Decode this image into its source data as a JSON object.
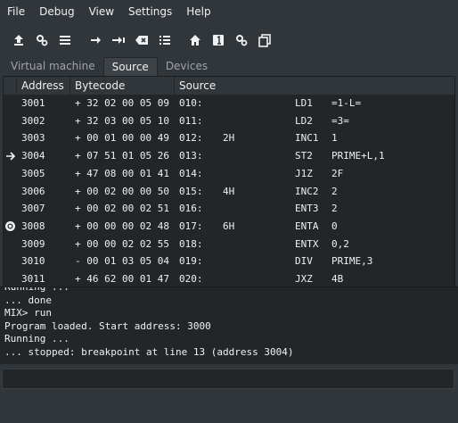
{
  "menu": [
    "File",
    "Debug",
    "View",
    "Settings",
    "Help"
  ],
  "toolbar": {
    "buttons": [
      "upload-icon",
      "gear-icon",
      "list-lines-icon",
      "arrow-right-icon",
      "step-into-icon",
      "clear-breakpoint-icon",
      "bullet-list-icon",
      "home-icon",
      "number-one-icon",
      "gears-icon",
      "copy-icon"
    ]
  },
  "tabs": [
    "Virtual machine",
    "Source",
    "Devices"
  ],
  "active_tab": "Source",
  "source": {
    "headers": {
      "address": "Address",
      "bytecode": "Bytecode",
      "source": "Source"
    },
    "rows": [
      {
        "marker": "",
        "addr": "3001",
        "bytecode": "+ 32 02 00 05 09",
        "label": "010:",
        "loc": "",
        "op": "LD1",
        "arg": "=1-L="
      },
      {
        "marker": "",
        "addr": "3002",
        "bytecode": "+ 32 03 00 05 10",
        "label": "011:",
        "loc": "",
        "op": "LD2",
        "arg": "=3="
      },
      {
        "marker": "",
        "addr": "3003",
        "bytecode": "+ 00 01 00 00 49",
        "label": "012:",
        "loc": "2H",
        "op": "INC1",
        "arg": "1"
      },
      {
        "marker": "current",
        "addr": "3004",
        "bytecode": "+ 07 51 01 05 26",
        "label": "013:",
        "loc": "",
        "op": "ST2",
        "arg": "PRIME+L,1"
      },
      {
        "marker": "",
        "addr": "3005",
        "bytecode": "+ 47 08 00 01 41",
        "label": "014:",
        "loc": "",
        "op": "J1Z",
        "arg": "2F"
      },
      {
        "marker": "",
        "addr": "3006",
        "bytecode": "+ 00 02 00 00 50",
        "label": "015:",
        "loc": "4H",
        "op": "INC2",
        "arg": "2"
      },
      {
        "marker": "",
        "addr": "3007",
        "bytecode": "+ 00 02 00 02 51",
        "label": "016:",
        "loc": "",
        "op": "ENT3",
        "arg": "2"
      },
      {
        "marker": "breakpoint",
        "addr": "3008",
        "bytecode": "+ 00 00 00 02 48",
        "label": "017:",
        "loc": "6H",
        "op": "ENTA",
        "arg": "0"
      },
      {
        "marker": "",
        "addr": "3009",
        "bytecode": "+ 00 00 02 02 55",
        "label": "018:",
        "loc": "",
        "op": "ENTX",
        "arg": "0,2"
      },
      {
        "marker": "",
        "addr": "3010",
        "bytecode": "- 00 01 03 05 04",
        "label": "019:",
        "loc": "",
        "op": "DIV",
        "arg": "PRIME,3"
      },
      {
        "marker": "",
        "addr": "3011",
        "bytecode": "+ 46 62 00 01 47",
        "label": "020:",
        "loc": "",
        "op": "JXZ",
        "arg": "4B"
      }
    ]
  },
  "console": {
    "lines": [
      "Running ...",
      "... done",
      "MIX> run",
      "Program loaded. Start address: 3000",
      "Running ...",
      "... stopped: breakpoint at line 13 (address 3004)"
    ]
  },
  "command_input": {
    "value": ""
  }
}
